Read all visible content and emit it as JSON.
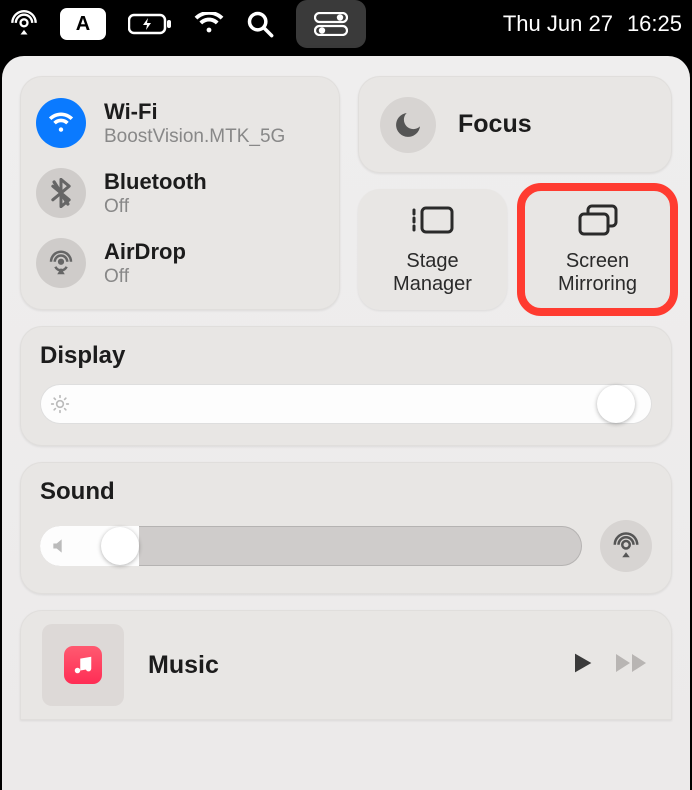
{
  "menubar": {
    "input_mode": "A",
    "date": "Thu Jun 27",
    "time": "16:25"
  },
  "connectivity": {
    "wifi": {
      "title": "Wi-Fi",
      "sub": "BoostVision.MTK_5G",
      "enabled": true
    },
    "bluetooth": {
      "title": "Bluetooth",
      "sub": "Off",
      "enabled": false
    },
    "airdrop": {
      "title": "AirDrop",
      "sub": "Off",
      "enabled": false
    }
  },
  "focus": {
    "label": "Focus"
  },
  "tiles": {
    "stage_manager": "Stage\nManager",
    "screen_mirroring": "Screen\nMirroring"
  },
  "display": {
    "title": "Display",
    "brightness_pct": 97
  },
  "sound": {
    "title": "Sound",
    "volume_pct": 12
  },
  "music": {
    "title": "Music"
  }
}
